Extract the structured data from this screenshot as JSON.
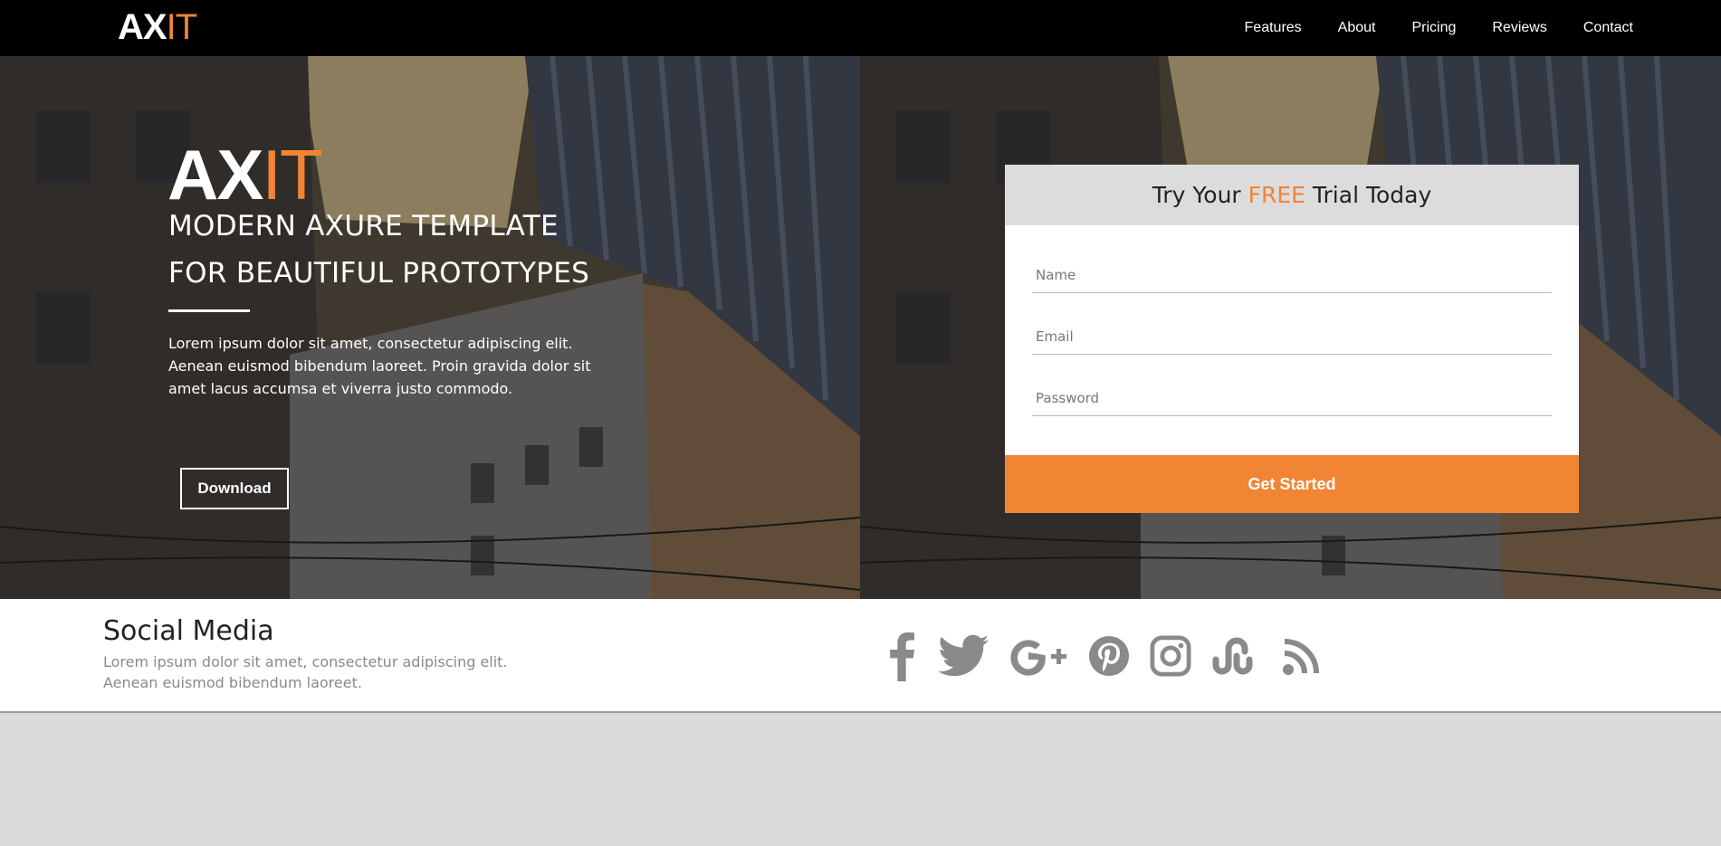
{
  "navbar": {
    "logo": {
      "ax": "AX",
      "it": "IT"
    },
    "links": [
      "Features",
      "About",
      "Pricing",
      "Reviews",
      "Contact"
    ]
  },
  "hero": {
    "logo": {
      "ax": "AX",
      "it": "IT"
    },
    "subtitle_line1": "MODERN AXURE TEMPLATE",
    "subtitle_line2": "FOR BEAUTIFUL PROTOTYPES",
    "paragraph": "Lorem ipsum dolor sit amet, consectetur adipiscing elit. Aenean euismod bibendum laoreet. Proin gravida dolor sit amet lacus accumsa et viverra justo commodo.",
    "download_label": "Download"
  },
  "form": {
    "title_prefix": "Try Your ",
    "title_highlight": "FREE",
    "title_suffix": " Trial Today",
    "name_placeholder": "Name",
    "email_placeholder": "Email",
    "password_placeholder": "Password",
    "submit_label": "Get Started"
  },
  "social": {
    "title": "Social Media",
    "text_line1": "Lorem ipsum dolor sit amet, consectetur adipiscing elit.",
    "text_line2": "Aenean euismod bibendum laoreet.",
    "icons": [
      "facebook-icon",
      "twitter-icon",
      "google-plus-icon",
      "pinterest-icon",
      "instagram-icon",
      "stumbleupon-icon",
      "rss-icon"
    ]
  },
  "colors": {
    "accent": "#f28534",
    "nav_bg": "#000000",
    "footer_bg": "#dadada",
    "icon_gray": "#8a8a8a"
  }
}
